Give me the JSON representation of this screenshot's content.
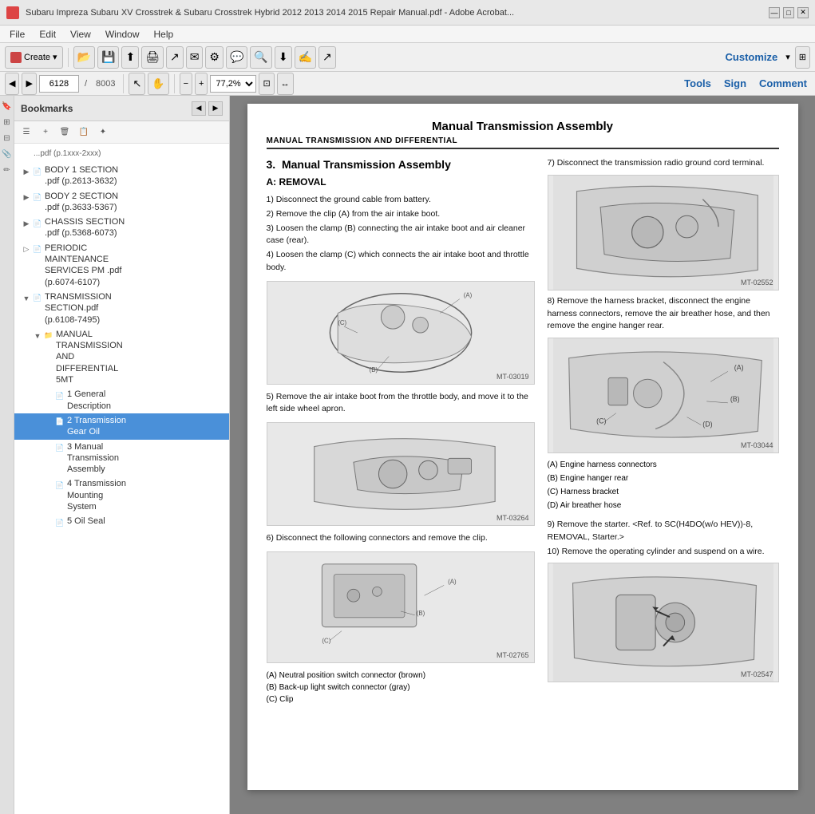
{
  "window": {
    "title": "Subaru Impreza Subaru XV Crosstrek & Subaru Crosstrek Hybrid 2012 2013 2014 2015 Repair Manual.pdf - Adobe Acrobat...",
    "icon": "pdf-icon"
  },
  "menu": {
    "items": [
      "File",
      "Edit",
      "View",
      "Window",
      "Help"
    ]
  },
  "toolbar": {
    "create_label": "Create",
    "page_number": "6128",
    "page_total": "8003",
    "zoom_value": "77,2%",
    "customize_label": "Customize",
    "tools_label": "Tools",
    "sign_label": "Sign",
    "comment_label": "Comment"
  },
  "sidebar": {
    "title": "Bookmarks",
    "items": [
      {
        "id": "body1",
        "label": "BODY 1 SECTION .pdf (p.2613-3632)",
        "level": 1,
        "expanded": false
      },
      {
        "id": "body2",
        "label": "BODY 2 SECTION .pdf (p.3633-5367)",
        "level": 1,
        "expanded": false
      },
      {
        "id": "chassis",
        "label": "CHASSIS SECTION .pdf (p.5368-6073)",
        "level": 1,
        "expanded": false
      },
      {
        "id": "periodic",
        "label": "PERIODIC MAINTENANCE SERVICES PM .pdf (p.6074-6107)",
        "level": 1,
        "expanded": false
      },
      {
        "id": "transmission",
        "label": "TRANSMISSION SECTION.pdf (p.6108-7495)",
        "level": 1,
        "expanded": true
      },
      {
        "id": "manual-trans",
        "label": "MANUAL TRANSMISSION AND DIFFERENTIAL 5MT",
        "level": 2,
        "expanded": true
      },
      {
        "id": "general",
        "label": "1 General Description",
        "level": 3,
        "expanded": false
      },
      {
        "id": "gear-oil",
        "label": "2 Transmission Gear Oil",
        "level": 3,
        "expanded": false,
        "selected": true
      },
      {
        "id": "assembly",
        "label": "3 Manual Transmission Assembly",
        "level": 3,
        "expanded": false
      },
      {
        "id": "mounting",
        "label": "4 Transmission Mounting System",
        "level": 3,
        "expanded": false
      },
      {
        "id": "oil-seal",
        "label": "5 Oil Seal",
        "level": 3,
        "expanded": false
      }
    ]
  },
  "pdf": {
    "page_title": "Manual Transmission Assembly",
    "section_label": "MANUAL TRANSMISSION AND DIFFERENTIAL",
    "section_number": "3.",
    "section_title": "Manual Transmission Assembly",
    "subsection": "A: REMOVAL",
    "steps": [
      "1) Disconnect the ground cable from battery.",
      "2) Remove the clip (A) from the air intake boot.",
      "3) Loosen the clamp (B) connecting the air intake boot and air cleaner case (rear).",
      "4) Loosen the clamp (C) which connects the air intake boot and throttle body.",
      "5) Remove the air intake boot from the throttle body, and move it to the left side wheel apron.",
      "6) Disconnect the following connectors and remove the clip.",
      "7) Disconnect the transmission radio ground cord terminal.",
      "8) Remove the harness bracket, disconnect the engine harness connectors, remove the air breather hose, and then remove the engine hanger rear.",
      "9) Remove the starter. <Ref. to SC(H4DO(w/o HEV))-8, REMOVAL, Starter.>",
      "10) Remove the operating cylinder and suspend on a wire."
    ],
    "captions_6": [
      "(A)  Neutral position switch connector (brown)",
      "(B)  Back-up light switch connector (gray)",
      "(C)  Clip"
    ],
    "legend_8": [
      "(A)  Engine harness connectors",
      "(B)  Engine hanger rear",
      "(C)  Harness bracket",
      "(D)  Air breather hose"
    ],
    "images": [
      {
        "id": "MT-03019",
        "label": "MT-03019"
      },
      {
        "id": "MT-03264",
        "label": "MT-03264"
      },
      {
        "id": "MT-02765",
        "label": "MT-02765"
      },
      {
        "id": "MT-02552",
        "label": "MT-02552"
      },
      {
        "id": "MT-03044",
        "label": "MT-03044"
      },
      {
        "id": "MT-02547",
        "label": "MT-02547"
      }
    ]
  }
}
